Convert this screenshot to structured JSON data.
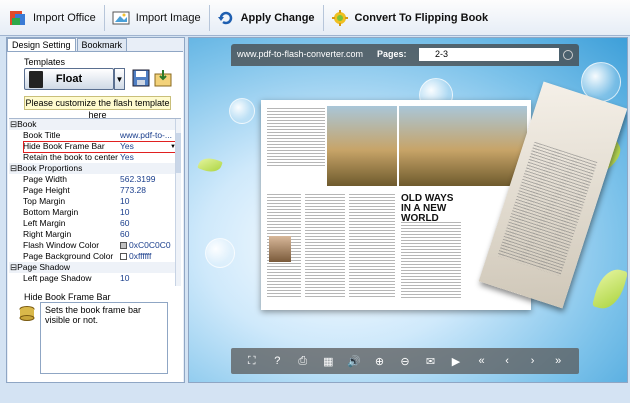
{
  "toolbar": {
    "import_office": "Import Office",
    "import_image": "Import Image",
    "apply_change": "Apply Change",
    "convert": "Convert To Flipping Book"
  },
  "tabs": [
    "Design Setting",
    "Bookmark"
  ],
  "templates": {
    "label": "Templates",
    "selected": "Float",
    "customize_hint": "Please customize the flash template here"
  },
  "properties": [
    {
      "key": "⊟Book",
      "value": "",
      "group": true
    },
    {
      "key": "Book Title",
      "value": "www.pdf-to-..."
    },
    {
      "key": "Hide Book Frame Bar",
      "value": "Yes",
      "selected": true
    },
    {
      "key": "Retain the book to center",
      "value": "Yes"
    },
    {
      "key": "⊟Book Proportions",
      "value": "",
      "group": true
    },
    {
      "key": "Page Width",
      "value": "562.3199"
    },
    {
      "key": "Page Height",
      "value": "773.28"
    },
    {
      "key": "Top Margin",
      "value": "10"
    },
    {
      "key": "Bottom Margin",
      "value": "10"
    },
    {
      "key": "Left Margin",
      "value": "60"
    },
    {
      "key": "Right Margin",
      "value": "60"
    },
    {
      "key": "Flash Window Color",
      "value": "0xC0C0C0",
      "swatch": "#C0C0C0"
    },
    {
      "key": "Page Background Color",
      "value": "0xffffff",
      "swatch": "#ffffff"
    },
    {
      "key": "⊟Page Shadow",
      "value": "",
      "group": true
    },
    {
      "key": "Left page Shadow",
      "value": "10"
    }
  ],
  "description": {
    "title": "Hide Book Frame Bar",
    "text": "Sets the book frame bar visible or not."
  },
  "viewer": {
    "url": "www.pdf-to-flash-converter.com",
    "pages_label": "Pages:",
    "pages_value": "2-3",
    "headline_right": "OLD WAYS IN A NEW WORLD"
  },
  "controls": [
    "⛶",
    "?",
    "⎙",
    "▦",
    "🔊",
    "⊕",
    "⊖",
    "✉",
    "▶",
    "«",
    "‹",
    "›",
    "»"
  ],
  "colors": {
    "accent": "#3d9fd9",
    "selection_border": "#e02020"
  }
}
